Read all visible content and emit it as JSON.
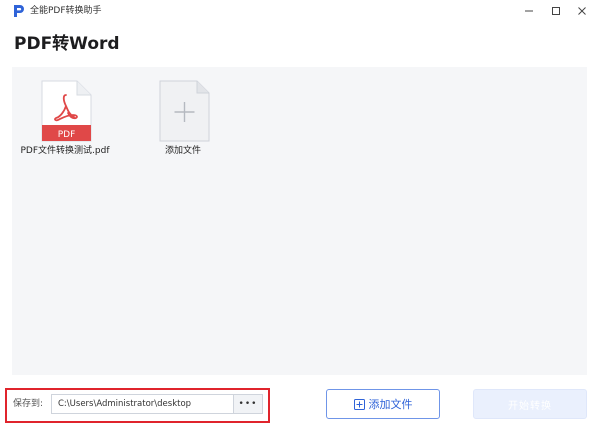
{
  "window": {
    "title": "全能PDF转换助手"
  },
  "page": {
    "title": "PDF转Word"
  },
  "files": [
    {
      "name": "PDF文件转换测试.pdf",
      "badge": "PDF"
    }
  ],
  "add_tile": {
    "label": "添加文件"
  },
  "footer": {
    "save_label": "保存到:",
    "save_path": "C:\\Users\\Administrator\\desktop",
    "browse_label": "•••",
    "add_button_label": "添加文件",
    "start_button_label": "开始转换"
  },
  "colors": {
    "accent": "#2f63d8",
    "pdf_red": "#e04848",
    "highlight": "#e0242c",
    "workspace_bg": "#f5f6f8"
  },
  "icons": {
    "app": "app-logo-icon",
    "minimize": "minimize-icon",
    "maximize": "maximize-icon",
    "close": "close-icon",
    "pdf_file": "pdf-file-icon",
    "add_file": "add-file-icon",
    "plus_small": "plus-square-icon"
  }
}
